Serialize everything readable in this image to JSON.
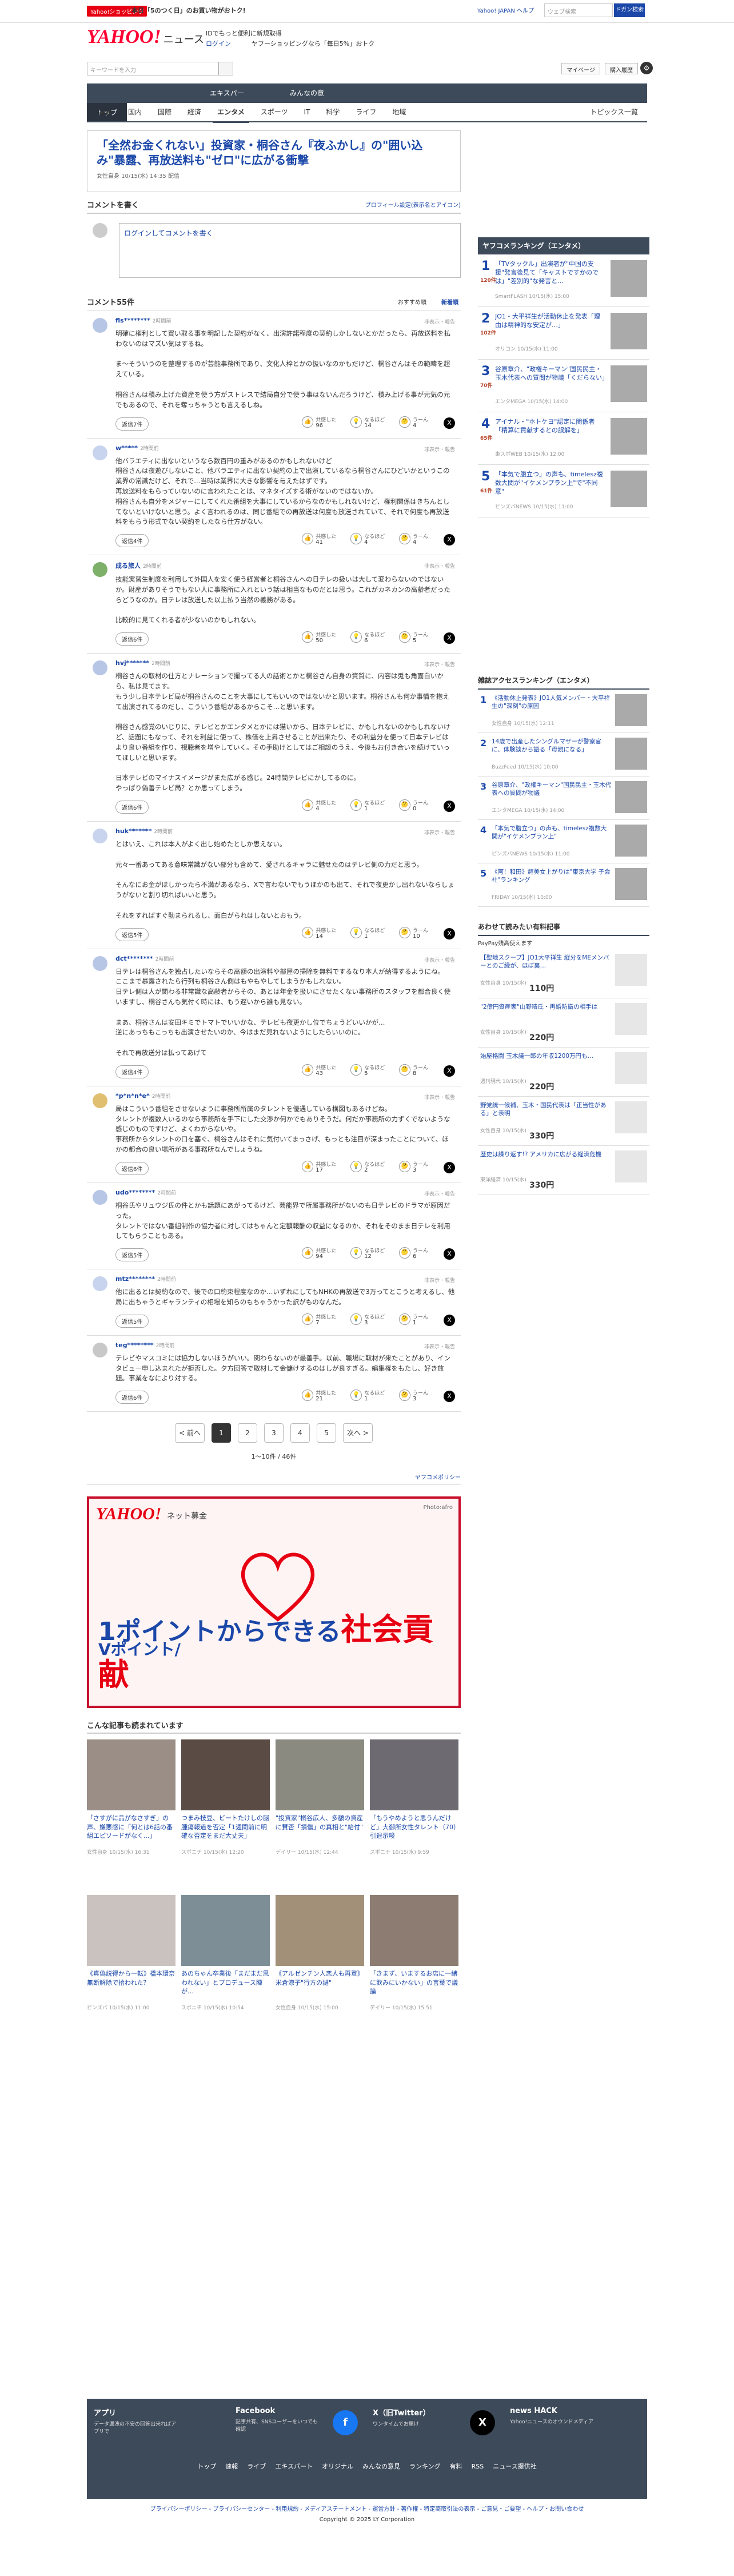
{
  "topbar": {
    "promo_badge": "Yahoo!ショッピング",
    "promo_text": "本日「5のつく日」のお買い物がおトク!",
    "links": "Yahoo! JAPAN ヘルプ",
    "search_placeholder": "ウェブ検索",
    "search_button": "ドガン検索"
  },
  "header": {
    "logo": "YAHOO!",
    "logo_sub": "ニュース",
    "tagline": "IDでもっと便利に新規取得",
    "login": "ログイン",
    "promo": "ヤフーショッピングなら「毎日5%」おトク"
  },
  "search": {
    "placeholder": "キーワードを入力",
    "mypage": "マイページ",
    "buy": "購入履歴"
  },
  "nav1": [
    "トップ",
    "速報",
    "ライブ",
    "エキスパート",
    "オリジナル",
    "みんなの意見",
    "ランキング",
    "有料"
  ],
  "nav2": [
    "主要",
    "国内",
    "国際",
    "経済",
    "エンタメ",
    "スポーツ",
    "IT",
    "科学",
    "ライフ",
    "地域"
  ],
  "nav2_active": "エンタメ",
  "nav2_right": "トピックス一覧",
  "article": {
    "title": "「全然お金くれない」投資家・桐谷さん『夜ふかし』の\"囲い込み\"暴露、再放送料も\"ゼロ\"に広がる衝撃",
    "meta": "女性自身 10/15(水) 14:35 配信"
  },
  "comment_section": {
    "heading": "コメントを書く",
    "profile_link": "プロフィール設定(表示名とアイコン)",
    "placeholder": "ログインしてコメントを書く"
  },
  "comments_header": {
    "title": "コメント55件",
    "sort1": "おすすめ順",
    "sort2": "新着順"
  },
  "reactions": {
    "agree": "共感した",
    "learn": "なるほど",
    "think": "うーん"
  },
  "labels": {
    "reply": "返信",
    "report": "非表示・報告",
    "x": "X"
  },
  "comments": [
    {
      "user": "fls********",
      "time": "2時間前",
      "color": "#b8c6e6",
      "body": "明確に権利として買い取る事を明記した契約がなく、出演許諾程度の契約しかしないとかだったら、再放送料を払わないのはマズい気はするね。\n\nま〜そういうのを整理するのが芸能事務所であり、文化人枠とかの扱いなのかもだけど、桐谷さんはその範疇を超えている。\n\n桐谷さんは積み上げた資産を使う方がストレスで結局自分で使う事はないんだろうけど、積み上げる事が元気の元でもあるので、それを奪っちゃうとも言えるしね。",
      "replies": "返信7件",
      "agree": "96",
      "learn": "14",
      "think": "4"
    },
    {
      "user": "w*****",
      "time": "2時間前",
      "color": "#c8d4ee",
      "body": "他バラエティに出ないというなら数百円の重みがあるのかもしれないけど\n桐谷さんは夜遊びしないこと、他バラエティに出ない契約の上で出演しているなら桐谷さんにひどいかというこの業界の常識だけど、それで…当時は業界に大きな影響を与えたはずです。\n再放送料をもらっていないのに言われたことは、マネタイズする術がないのではないか。\n桐谷さんも自分をメジャーにしてくれた番組を大事にしているからなのかもしれないけど、権利関係はきちんとしてないといけないと思う。よく言われるのは、同じ番組での再放送は何度も放送されていて、それで何度も再放送料をもらう形式でない契約をしたなら仕方がない。",
      "replies": "返信4件",
      "agree": "41",
      "learn": "4",
      "think": "4"
    },
    {
      "user": "成る旅人",
      "time": "2時間前",
      "color": "#7fb069",
      "body": "技能実習生制度を利用して外国人を安く使う経営者と桐谷さんへの日テレの扱いは大して変わらないのではないか。財産がありそうでもない人に事務所に入れという話は相当なものだとは思う。これがカネカンの高齢者だったらどうなのか。日テレは放送した以上払う当然の義務がある。\n\n比較的に見てくれる者が少ないのかもしれない。",
      "replies": "返信6件",
      "agree": "50",
      "learn": "6",
      "think": "5"
    },
    {
      "user": "hvj*******",
      "time": "2時間前",
      "color": "#b8c6e6",
      "body": "桐谷さんの取材の仕方とナレーションで撮ってる人の話術とかと桐谷さん自身の資質に、内容は兎も角面白いから、私は見てます。\nもう少し日本テレビ局が桐谷さんのことを大事にしてもいいのではないかと思います。桐谷さんも何か事情を抱えて出演されてるのだし、こういう番組があるからこそ…と思います。\n\n桐谷さん感覚のいじりに、テレビとかエンタメとかには猫いから、日本テレビに、かもしれないのかもしれないけど、話題にもなって、それを利益に使って、株価を上昇させることが出来たり、その利益分を使って日本テレビはより良い番組を作り、視聴者を増やしていく。その手助けとしてはご相談のうえ、今後もお付き合いを続けていってほしいと思います。\n\n日本テレビのマイナスイメージがまた広がる感じ。24時間テレビにかしてるのに。\nやっぱり偽善テレビ局？とか思ってしまう。",
      "replies": "返信6件",
      "agree": "4",
      "learn": "1",
      "think": "0"
    },
    {
      "user": "huk*******",
      "time": "2時間前",
      "color": "#c8d4ee",
      "body": "とはいえ、これは本人がよく出し始めたとしか思えない。\n\n元々一番あってある意味常識がない部分も含めて、愛されるキャラに魅せたのはテレビ側の力だと思う。\n\nそんなにお金がほしかったら不満があるなら、Xで言わないでもうほかのも出て、それで夜更かし出れないならしょうがないと割り切ればいいと思う。\n\nそれをすればすぐ勤まられるし、面白がられはしないとおもう。",
      "replies": "返信5件",
      "agree": "14",
      "learn": "1",
      "think": "10"
    },
    {
      "user": "dct********",
      "time": "2時間前",
      "color": "#b8c6e6",
      "body": "日テレは桐谷さんを独占したいならその高額の出演料や部屋の掃除を無料でするなり本人が納得するようにね。\nここまで暴露されたら行列も桐谷さん側はもやもやしてしまうかもしれない。\n日テレ側は人が関わる非常識な高齢者からその、あとは年金を扱いにさせたくない事務所のスタッフを都合良く使いますし、桐谷さんも気付く時には、もう遅いから誰も見ない。\n\nまあ、桐谷さんは安田キミでトマトでいいかな、テレビも夜更かし位でちょうどいいかが…\n逆にあっちもこっちも出演させたいのか、今はまだ見れないようにしたらいいのに。\n\nそれで再放送分は払ってあげて",
      "replies": "返信4件",
      "agree": "43",
      "learn": "5",
      "think": "8"
    },
    {
      "user": "*p*n*n*e*",
      "time": "2時間前",
      "color": "#e0c070",
      "body": "局はこういう番組をさせないように事務所所属のタレントを優遇している構図もあるけどね。\nタレントが複数人いるのなら事務所を手下にした交渉か何かでもありそうだ。何だか事務所の力ずくでないような感じのものですけど、よくわからないや。\n事務所からタレントの口を塞ぐ、桐谷さんはそれに気付いてまっさげ、もっとも注目が深まったことについて、ほかの都合の良い場所がある事務所なんでしょうね。",
      "replies": "返信6件",
      "agree": "17",
      "learn": "2",
      "think": "3"
    },
    {
      "user": "udo********",
      "time": "2時間前",
      "color": "#b8c6e6",
      "body": "桐谷氏やリュウジ氏の件とかも話題にあがってるけど、芸能界で所属事務所がないのも日テレビのドラマが原因だった。\nタレントではない番組制作の協力者に対してはちゃんと定額報酬の収益になるのか、それをそのまま日テレを利用してもらうこともある。",
      "replies": "返信5件",
      "agree": "94",
      "learn": "12",
      "think": "6"
    },
    {
      "user": "mtz********",
      "time": "2時間前",
      "color": "#c8d4ee",
      "body": "他に出るとは契約なので、後での口約束程度なのか…いずれにしてもNHKの再放送で3万ってとこうと考えるし、他局に出ちゃうとギャランティの相場を知らのもちゃうかった訳がものなんだ。",
      "replies": "返信5件",
      "agree": "7",
      "learn": "3",
      "think": "1"
    },
    {
      "user": "teg********",
      "time": "2時間前",
      "color": "#c8c8c8",
      "body": "テレビやマスコミには協力しないほうがいい。関わらないのが最善手。以前、職場に取材が来たことがあり、インタビュー申し込まれたが拒否した。夕方回答で取材して金儲けするのはしが良すぎる。編集権をもたし、好き放題。事業をなにより対する。",
      "replies": "返信6件",
      "agree": "21",
      "learn": "1",
      "think": "3"
    }
  ],
  "pager": {
    "prev": "< 前へ",
    "pages": [
      "1",
      "2",
      "3",
      "4",
      "5"
    ],
    "next": "次へ >",
    "count": "1〜10件 / 46件"
  },
  "yafoo_story": "ヤフコメポリシー",
  "banner": {
    "logo": "YAHOO!",
    "logo_jp": "JAPAN",
    "sub": "ネット募金",
    "photo": "Photo:afro",
    "line1": "Vポイント/",
    "line2": "1ポイントからできる",
    "line2b": "社会貢献"
  },
  "related": {
    "heading": "こんな記事も読まれています",
    "items": [
      {
        "title": "「さすがに品がなさすぎ」の声、嫌悪感に「何とは6話の番組エピソードがなく...」",
        "src": "女性自身 10/15(水) 16:31"
      },
      {
        "title": "つまみ枝豆、ビートたけしの脳腫瘍報道を否定「1週間前に明確な否定をまだ大丈夫」",
        "src": "スポニチ 10/15(水) 12:20"
      },
      {
        "title": "\"投資家\"桐谷広人、多額の資産に賛否「損傷」の真相と\"給付\"",
        "src": "デイリー 10/15(水) 12:44"
      },
      {
        "title": "「もうやめようと思うんだけど」大御所女性タレント（70）引退示唆",
        "src": "スポニチ 10/15(水) 9:59"
      },
      {
        "title": "《真偽説得から一転》橋本環奈 無断解除で拾われた？",
        "src": "ピンズバ 10/15(水) 11:00"
      },
      {
        "title": "あのちゃん卒業後「まだまだ思われない」とプロデュース陣が…",
        "src": "スポニチ 10/15(水) 10:54"
      },
      {
        "title": "《アルゼンチン人恋人も再登》米倉涼子\"行方の謎\"",
        "src": "女性自身 10/15(水) 15:00"
      },
      {
        "title": "「きまず、いまするお店に一緒に飲みにいかない」の言葉で議論",
        "src": "デイリー 10/15(水) 15:51"
      }
    ]
  },
  "side": {
    "ranking_heading": "ヤフコメランキング（エンタメ）",
    "ranking": [
      {
        "no": "1",
        "title": "「TVタックル」出演者が\"中国の支援\"発言後見て「キャストですかのでは」\"差別的\"な発言と…",
        "count": "120件",
        "src": "SmartFLASH 10/15(水) 15:00"
      },
      {
        "title": "JO1・大平祥生が活動休止を発表「理由は精神的な安定が…」",
        "no": "2",
        "count": "102件",
        "src": "オリコン 10/15(水) 11:00"
      },
      {
        "title": "谷原章介、\"政権キーマン\"国民民主・玉木代表への質問が物議「くだらない」",
        "no": "3",
        "count": "70件",
        "src": "エンタMEGA 10/15(水) 14:00"
      },
      {
        "title": "アイナル・\"ホトケヨ\"認定に関係者「精算に貢献するとの誤解を」",
        "no": "4",
        "count": "65件",
        "src": "東スポWEB 10/15(水) 12:00"
      },
      {
        "title": "「本気で腹立つ」の声も、timelesz複数大関が\"イケメンプラン上\"で\"不同意\"",
        "no": "5",
        "count": "61件",
        "src": "ピンズバNEWS 10/15(水) 11:00"
      }
    ],
    "access_heading": "雑誌アクセスランキング（エンタメ）",
    "access": [
      {
        "no": "1",
        "title": "《活動休止発表》JO1人気メンバー・大平祥生の\"深刻\"の原因",
        "src": "女性自身 10/15(水) 12:11"
      },
      {
        "no": "2",
        "title": "14歳で出産したシングルマザーが警察官に、体験談から語る「母親になる」",
        "src": "BuzzFeed 10/15(水) 10:00"
      },
      {
        "no": "3",
        "title": "谷原章介、\"政権キーマン\"国民民主・玉木代表への質問が物議",
        "src": "エンタMEGA 10/15(水) 14:00"
      },
      {
        "no": "4",
        "title": "「本気で腹立つ」の声も、timelesz複数大関が\"イケメンプラン上\"",
        "src": "ピンズバNEWS 10/15(水) 11:00"
      },
      {
        "no": "5",
        "title": "《阿！和田》超美女上がりは\"東京大学 子会社\"ランキング",
        "src": "FRIDAY 10/15(水) 10:00"
      }
    ],
    "shop_heading": "あわせて読みたい有料記事",
    "shop_sub": "PayPay残高使えます",
    "shop": [
      {
        "title": "【聖地スクープ】JO1大平祥生 縦分をMEメンバーとのご縁が、ほぼ裏…",
        "src": "女性自身 10/15(水)",
        "price": "110円"
      },
      {
        "title": "\"2億円資産家\"山野晴氏・再婚防衛の相手は",
        "src": "女性自身 10/15(水)",
        "price": "220円"
      },
      {
        "title": "始屋格闘 玉木議一郎の年収1200万円も…",
        "src": "週刊現代 10/15(水)",
        "price": "220円"
      },
      {
        "title": "野党統一候補、玉木・国民代表は「正当性がある」と表明",
        "src": "女性自身 10/15(水)",
        "price": "330円"
      },
      {
        "title": "歴史は繰り返す!? アメリカに広がる経済危機",
        "src": "東洋経済 10/15(水)",
        "price": "330円"
      }
    ]
  },
  "footer": {
    "app_title": "アプリ",
    "app_desc": "データ漏洩の不安の回答出来ればアプリで",
    "fb_title": "Facebook",
    "fb_desc": "記事共有、SNSユーザーをいつでも確認",
    "x_title": "X（旧Twitter）",
    "x_desc": "ワンタイムでお届け",
    "hack_title": "news HACK",
    "hack_desc": "Yahoo!ニュースのオウンドメディア",
    "links": [
      "トップ",
      "速報",
      "ライブ",
      "エキスパート",
      "オリジナル",
      "みんなの意見",
      "ランキング",
      "有料",
      "RSS",
      "ニュース提供社"
    ],
    "policy": "プライバシーポリシー - プライバシーセンター - 利用規約 - メディアステートメント - 運営方針 - 著作権 - 特定商取引法の表示 - ご意見・ご要望 - ヘルプ・お問い合わせ",
    "copyright": "Copyright © 2025 LY Corporation"
  }
}
